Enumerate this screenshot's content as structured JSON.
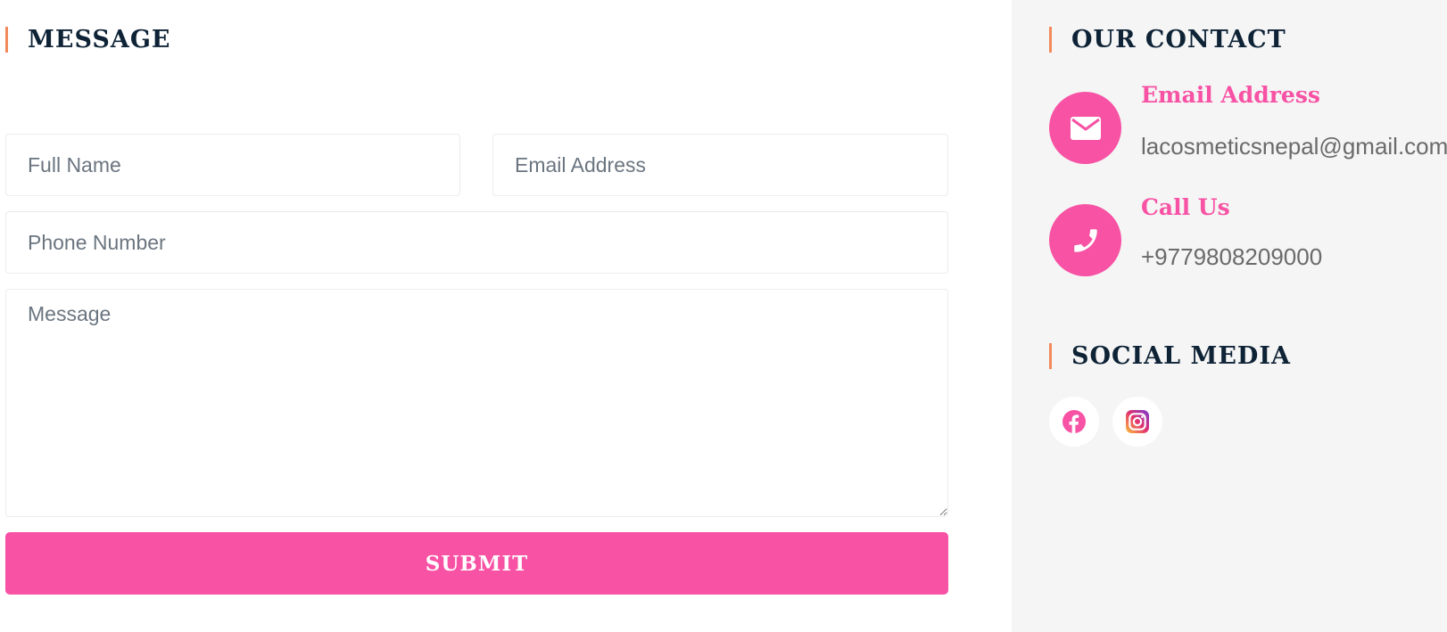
{
  "message_section": {
    "title": "MESSAGE",
    "full_name_placeholder": "Full Name",
    "email_placeholder": "Email Address",
    "phone_placeholder": "Phone Number",
    "message_placeholder": "Message",
    "submit_label": "SUBMIT"
  },
  "contact_section": {
    "title": "OUR CONTACT",
    "items": [
      {
        "label": "Email Address",
        "value": "lacosmeticsnepal@gmail.com",
        "icon": "envelope-icon"
      },
      {
        "label": "Call Us",
        "value": "+9779808209000",
        "icon": "phone-icon"
      }
    ]
  },
  "social_section": {
    "title": "SOCIAL MEDIA",
    "links": [
      {
        "icon": "facebook-icon"
      },
      {
        "icon": "instagram-icon"
      }
    ]
  },
  "colors": {
    "accent": "#f752a4",
    "title_bar": "#f28a5c",
    "heading": "#0e2336",
    "sidebar_bg": "#f5f5f5"
  }
}
